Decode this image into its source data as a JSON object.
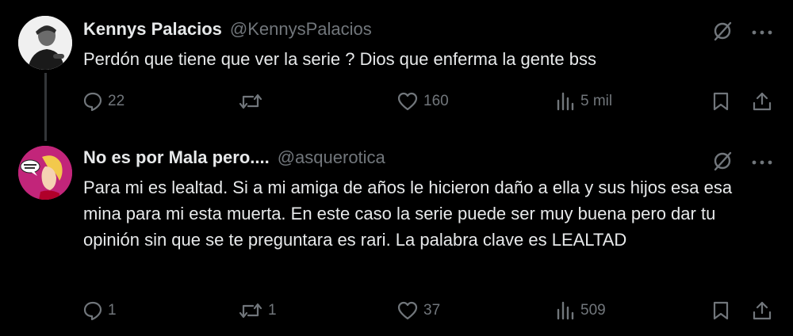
{
  "tweets": [
    {
      "author_name": "Kennys Palacios",
      "author_handle": "@KennysPalacios",
      "text": "Perdón que tiene que ver la serie ? Dios que enferma la gente bss",
      "stats": {
        "replies": "22",
        "reposts": "",
        "likes": "160",
        "views": "5 mil"
      }
    },
    {
      "author_name": "No es por Mala pero....",
      "author_handle": "@asquerotica",
      "text": "Para mi es lealtad. Si a mi amiga de años le hicieron daño a ella y sus hijos esa  esa mina para mi esta muerta. En este caso la serie puede ser muy buena pero dar tu opinión sin que se te preguntara es rari. La palabra clave es LEALTAD",
      "stats": {
        "replies": "1",
        "reposts": "1",
        "likes": "37",
        "views": "509"
      }
    }
  ],
  "colors": {
    "background": "#000000",
    "text": "#e7e9ea",
    "muted": "#71767b",
    "line": "#333639"
  }
}
